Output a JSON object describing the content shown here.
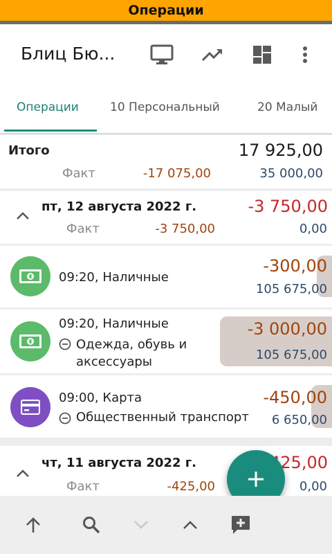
{
  "status_bar": {
    "title": "Операции"
  },
  "app": {
    "title": "Блиц Бю..."
  },
  "toolbar": {
    "icons": [
      "monitor-icon",
      "trending-up-icon",
      "dashboard-icon",
      "more-vert-icon"
    ]
  },
  "tabs": [
    {
      "label": "Операции",
      "active": true
    },
    {
      "label": "10 Персональный",
      "active": false
    },
    {
      "label": "20 Малый",
      "active": false
    }
  ],
  "summary": {
    "label": "Итого",
    "total": "17 925,00",
    "fact_label": "Факт",
    "fact_expense": "-17 075,00",
    "fact_income": "35 000,00"
  },
  "days": [
    {
      "date": "пт, 12 августа 2022 г.",
      "total": "-3 750,00",
      "fact_label": "Факт",
      "fact_expense": "-3 750,00",
      "fact_income": "0,00",
      "transactions": [
        {
          "time_account": "09:20, Наличные",
          "category": "",
          "amount": "-300,00",
          "balance": "105 675,00",
          "icon": "cash-icon",
          "color": "#5cbb6a"
        },
        {
          "time_account": "09:20, Наличные",
          "category": "Одежда, обувь и аксессуары",
          "amount": "-3 000,00",
          "balance": "105 675,00",
          "icon": "cash-icon",
          "color": "#5cbb6a"
        },
        {
          "time_account": "09:00, Карта",
          "category": "Общественный транспорт",
          "amount": "-450,00",
          "balance": "6 650,00",
          "icon": "credit-card-icon",
          "color": "#7e4fc2"
        }
      ]
    },
    {
      "date": "чт, 11 августа 2022 г.",
      "total": "-425,00",
      "fact_label": "Факт",
      "fact_expense": "-425,00",
      "fact_income": "0,00"
    }
  ],
  "bottom_bar": {
    "icons": [
      "arrow-up-icon",
      "search-icon",
      "chevron-down-icon",
      "chevron-up-icon",
      "add-comment-icon"
    ]
  },
  "colors": {
    "accent": "#1a8c7d",
    "status_bar": "#ffa500",
    "expense": "#a0450e",
    "day_total": "#c62828",
    "income": "#2e4a6b"
  }
}
